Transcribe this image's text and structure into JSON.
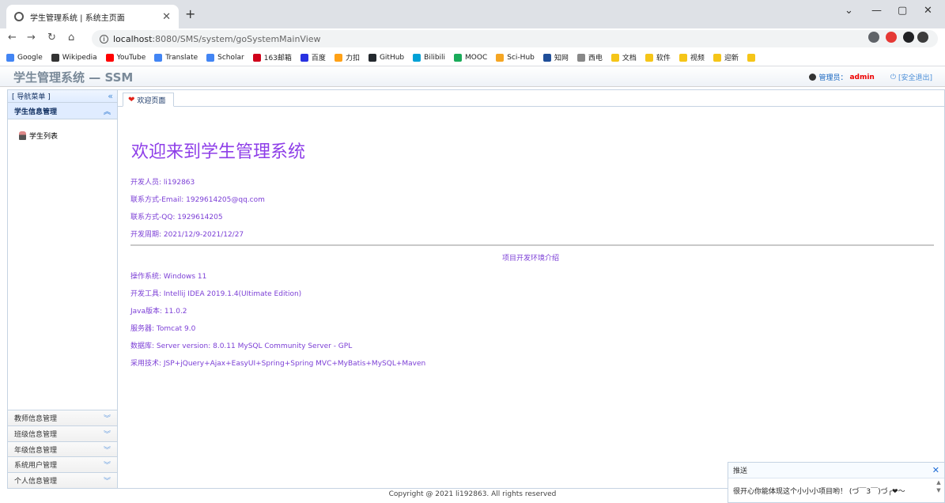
{
  "browser": {
    "tab_title": "学生管理系统 | 系统主页面",
    "url_host": "localhost",
    "url_path": ":8080/SMS/system/goSystemMainView",
    "bookmarks": [
      {
        "label": "Google",
        "color": "#4285f4"
      },
      {
        "label": "Wikipedia",
        "color": "#333333"
      },
      {
        "label": "YouTube",
        "color": "#ff0000"
      },
      {
        "label": "Translate",
        "color": "#4285f4"
      },
      {
        "label": "Scholar",
        "color": "#4285f4"
      },
      {
        "label": "163邮箱",
        "color": "#d0021b"
      },
      {
        "label": "百度",
        "color": "#2932e1"
      },
      {
        "label": "力扣",
        "color": "#ffa116"
      },
      {
        "label": "GitHub",
        "color": "#24292e"
      },
      {
        "label": "Bilibili",
        "color": "#00a1d6"
      },
      {
        "label": "MOOC",
        "color": "#1aab5a"
      },
      {
        "label": "Sci-Hub",
        "color": "#f5a623"
      },
      {
        "label": "知网",
        "color": "#1f4e99"
      },
      {
        "label": "西电",
        "color": "#888888"
      },
      {
        "label": "文档",
        "color": "#f5c518"
      },
      {
        "label": "软件",
        "color": "#f5c518"
      },
      {
        "label": "视频",
        "color": "#f5c518"
      },
      {
        "label": "迎新",
        "color": "#f5c518"
      },
      {
        "label": "",
        "color": "#f5c518"
      }
    ]
  },
  "header": {
    "app_title": "学生管理系统 — SSM",
    "role_label": "管理员：",
    "user_name": "admin",
    "logout_label": "[安全退出]"
  },
  "sidebar": {
    "header_label": "[ 导航菜单 ]",
    "active_group": "学生信息管理",
    "active_item": "学生列表",
    "collapsed_groups": [
      "教师信息管理",
      "班级信息管理",
      "年级信息管理",
      "系统用户管理",
      "个人信息管理"
    ]
  },
  "main": {
    "tab_label": "欢迎页面",
    "welcome": "欢迎来到学生管理系统",
    "dev_info": [
      "开发人员: li192863",
      "联系方式-Email: 1929614205@qq.com",
      "联系方式-QQ: 1929614205",
      "开发周期: 2021/12/9-2021/12/27"
    ],
    "env_title": "项目开发环境介绍",
    "env_info": [
      "操作系统: Windows 11",
      "开发工具: Intellij IDEA 2019.1.4(UItimate Edition)",
      "Java版本: 11.0.2",
      "服务器: Tomcat 9.0",
      "数据库: Server version: 8.0.11 MySQL Community Server - GPL",
      "采用技术: JSP+jQuery+Ajax+EasyUI+Spring+Spring MVC+MyBatis+MySQL+Maven"
    ]
  },
  "footer": {
    "copyright": "Copyright @ 2021 li192863. All rights reserved"
  },
  "notification": {
    "title": "推送",
    "message": "很开心你能体现这个小小小项目哟！ (づ￣3￣)づ╭❤～"
  }
}
